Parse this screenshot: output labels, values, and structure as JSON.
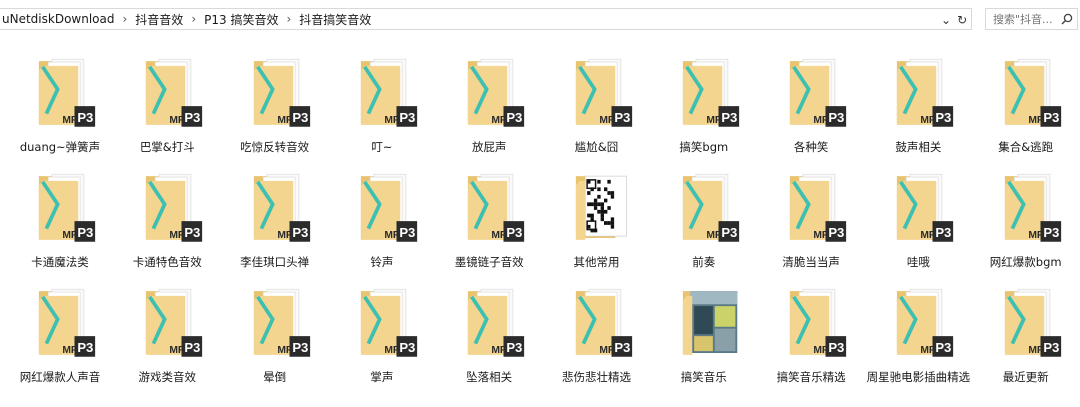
{
  "address_bar": {
    "crumbs": [
      "uNetdiskDownload",
      "抖音音效",
      "P13 搞笑音效",
      "抖音搞笑音效"
    ],
    "separator": "›",
    "dropdown_glyph": "⌄",
    "refresh_glyph": "↻"
  },
  "search": {
    "placeholder": "搜索\"抖音...",
    "icon": "search-icon"
  },
  "folders": [
    {
      "label": "duang~弹簧声",
      "icon": "mp3-folder-icon"
    },
    {
      "label": "巴掌&打斗",
      "icon": "mp3-folder-icon"
    },
    {
      "label": "吃惊反转音效",
      "icon": "mp3-folder-icon"
    },
    {
      "label": "叮~",
      "icon": "mp3-folder-icon"
    },
    {
      "label": "放屁声",
      "icon": "mp3-folder-icon"
    },
    {
      "label": "尴尬&囧",
      "icon": "mp3-folder-icon"
    },
    {
      "label": "搞笑bgm",
      "icon": "mp3-folder-icon"
    },
    {
      "label": "各种笑",
      "icon": "mp3-folder-icon"
    },
    {
      "label": "鼓声相关",
      "icon": "mp3-folder-icon"
    },
    {
      "label": "集合&逃跑",
      "icon": "mp3-folder-icon"
    },
    {
      "label": "卡通魔法类",
      "icon": "mp3-folder-icon"
    },
    {
      "label": "卡通特色音效",
      "icon": "mp3-folder-icon"
    },
    {
      "label": "李佳琪口头禅",
      "icon": "mp3-folder-icon"
    },
    {
      "label": "铃声",
      "icon": "mp3-folder-icon"
    },
    {
      "label": "墨镜链子音效",
      "icon": "mp3-folder-icon"
    },
    {
      "label": "其他常用",
      "icon": "qr-folder-icon"
    },
    {
      "label": "前奏",
      "icon": "mp3-folder-icon"
    },
    {
      "label": "清脆当当声",
      "icon": "mp3-folder-icon"
    },
    {
      "label": "哇哦",
      "icon": "mp3-folder-icon"
    },
    {
      "label": "网红爆款bgm",
      "icon": "mp3-folder-icon"
    },
    {
      "label": "网红爆款人声音",
      "icon": "mp3-folder-icon"
    },
    {
      "label": "游戏类音效",
      "icon": "mp3-folder-icon"
    },
    {
      "label": "晕倒",
      "icon": "mp3-folder-icon"
    },
    {
      "label": "掌声",
      "icon": "mp3-folder-icon"
    },
    {
      "label": "坠落相关",
      "icon": "mp3-folder-icon"
    },
    {
      "label": "悲伤悲壮精选",
      "icon": "mp3-folder-icon"
    },
    {
      "label": "搞笑音乐",
      "icon": "magazine-folder-icon"
    },
    {
      "label": "搞笑音乐精选",
      "icon": "mp3-folder-icon"
    },
    {
      "label": "周星驰电影插曲精选",
      "icon": "mp3-folder-icon"
    },
    {
      "label": "最近更新",
      "icon": "mp3-folder-icon"
    }
  ],
  "colors": {
    "folder_body": "#f3d58f",
    "folder_back": "#e9c36d",
    "accent_teal": "#3cc0b2",
    "mp3_dark": "#2b2b2b"
  }
}
